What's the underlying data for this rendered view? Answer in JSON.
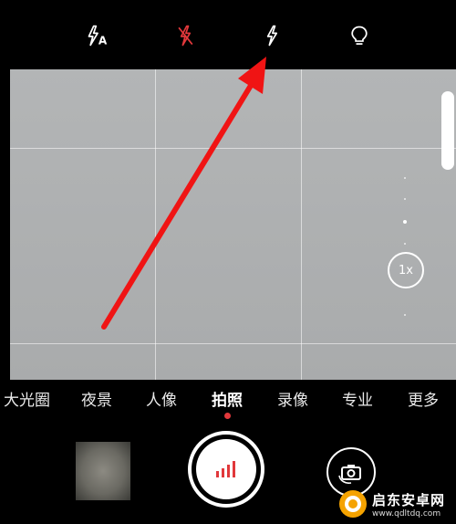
{
  "flash_modes": [
    {
      "name": "auto",
      "icon": "flash-auto-icon",
      "label": "A"
    },
    {
      "name": "off",
      "icon": "flash-off-icon",
      "color": "#e1383b"
    },
    {
      "name": "on",
      "icon": "flash-on-icon"
    },
    {
      "name": "torch",
      "icon": "bulb-icon"
    }
  ],
  "zoom": {
    "label": "1x"
  },
  "modes": [
    {
      "label": "大光圈"
    },
    {
      "label": "夜景"
    },
    {
      "label": "人像"
    },
    {
      "label": "拍照",
      "active": true
    },
    {
      "label": "录像"
    },
    {
      "label": "专业"
    },
    {
      "label": "更多"
    }
  ],
  "colors": {
    "accent": "#e1383b",
    "arrow": "#f01414"
  },
  "watermark": {
    "title": "启东安卓网",
    "url": "www.qdltdq.com"
  }
}
